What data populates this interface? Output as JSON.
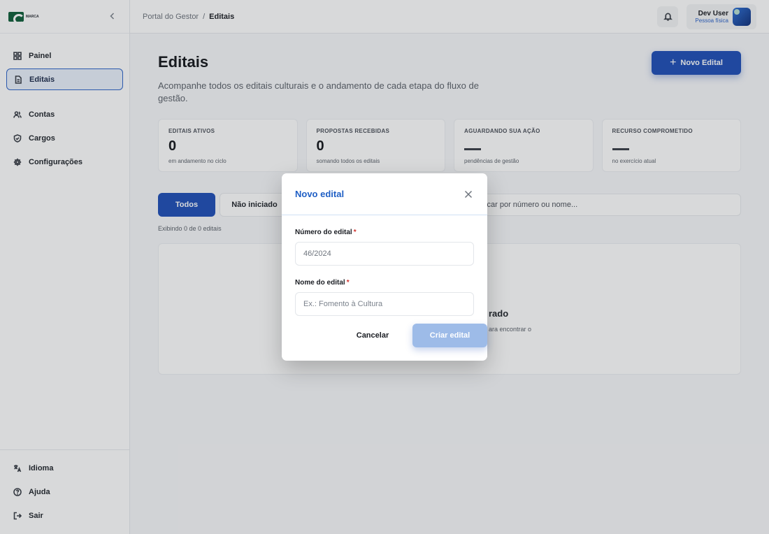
{
  "brand": {
    "name": "MARCA",
    "tagline": ""
  },
  "sidebar": {
    "items": [
      {
        "label": "Painel",
        "icon": "grid-icon"
      },
      {
        "label": "Editais",
        "icon": "document-icon",
        "active": true
      },
      {
        "label": "Contas",
        "icon": "users-icon"
      },
      {
        "label": "Cargos",
        "icon": "shield-icon"
      },
      {
        "label": "Configurações",
        "icon": "gear-icon"
      }
    ],
    "bottom": [
      {
        "label": "Idioma",
        "icon": "translate-icon"
      },
      {
        "label": "Ajuda",
        "icon": "help-icon"
      },
      {
        "label": "Sair",
        "icon": "logout-icon"
      }
    ]
  },
  "topbar": {
    "breadcrumb": {
      "root": "Portal do Gestor",
      "separator": "/",
      "current": "Editais"
    },
    "user": {
      "name": "Dev User",
      "role": "Pessoa física"
    }
  },
  "page": {
    "title": "Editais",
    "description": "Acompanhe todos os editais culturais e o andamento de cada etapa do fluxo de gestão.",
    "new_button": "Novo Edital"
  },
  "stats": [
    {
      "label": "EDITAIS ATIVOS",
      "value": "0",
      "sub": "em andamento no ciclo"
    },
    {
      "label": "PROPOSTAS RECEBIDAS",
      "value": "0",
      "sub": "somando todos os editais"
    },
    {
      "label": "AGUARDANDO SUA AÇÃO",
      "value": "",
      "sub": "pendências de gestão"
    },
    {
      "label": "RECURSO COMPROMETIDO",
      "value": "",
      "sub": "no exercício atual"
    }
  ],
  "filters": {
    "all": "Todos",
    "not_started": "Não iniciado",
    "search_placeholder": "Buscar por número ou nome...",
    "search_visible": "scar por número ou nome..."
  },
  "counter": "Exibindo 0 de 0 editais",
  "empty": {
    "title": "rado",
    "subtitle": "ara encontrar o"
  },
  "modal": {
    "title": "Novo edital",
    "number_label": "Número do edital",
    "number_value": "46/2024",
    "name_label": "Nome do edital",
    "name_placeholder": "Ex.: Fomento à Cultura",
    "required_mark": "*",
    "cancel": "Cancelar",
    "create": "Criar edital"
  },
  "colors": {
    "primary": "#1f4fb8",
    "modal_title": "#1f5fc5",
    "required": "#d0312d",
    "create_disabled": "#9dbbe8"
  }
}
